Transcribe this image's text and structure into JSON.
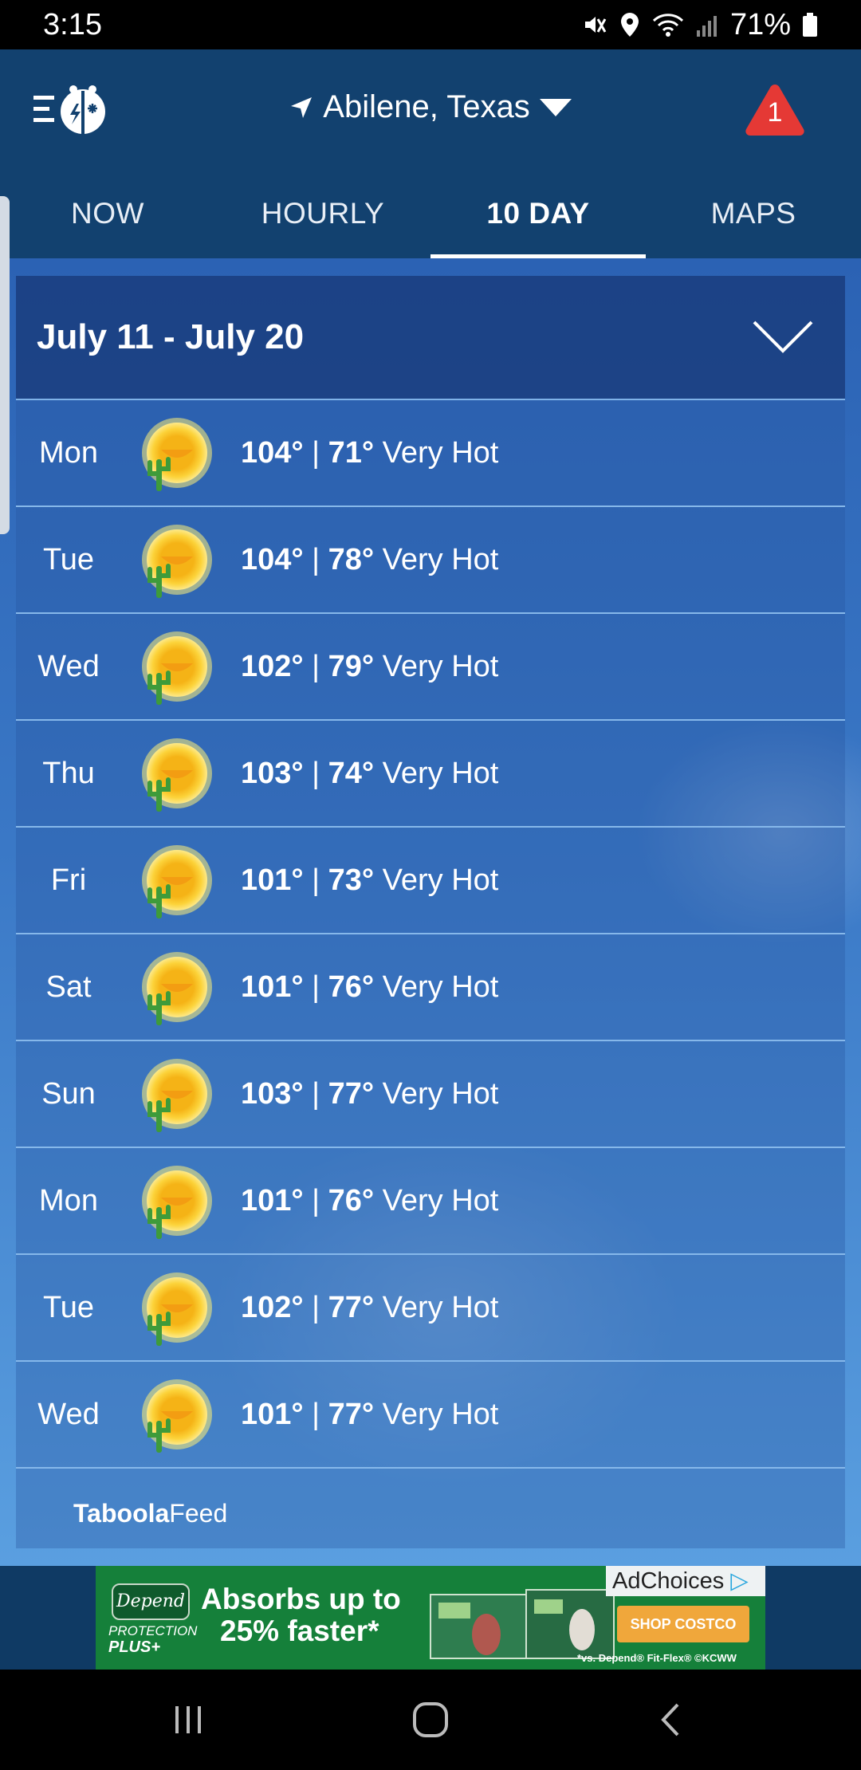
{
  "status_bar": {
    "time": "3:15",
    "battery": "71%",
    "icons": [
      "mute-icon",
      "location-icon",
      "wifi-icon",
      "signal-icon",
      "battery-icon"
    ]
  },
  "header": {
    "location": "Abilene, Texas",
    "alert_count": "1",
    "alert_color": "#e53935"
  },
  "tabs": [
    {
      "label": "NOW"
    },
    {
      "label": "HOURLY"
    },
    {
      "label": "10 DAY",
      "active": true
    },
    {
      "label": "MAPS"
    }
  ],
  "forecast": {
    "range": "July 11 - July 20",
    "days": [
      {
        "day": "Mon",
        "high": "104°",
        "low": "71°",
        "desc": "Very Hot",
        "icon": "hot-sun-cactus-icon"
      },
      {
        "day": "Tue",
        "high": "104°",
        "low": "78°",
        "desc": "Very Hot",
        "icon": "hot-sun-cactus-icon"
      },
      {
        "day": "Wed",
        "high": "102°",
        "low": "79°",
        "desc": "Very Hot",
        "icon": "hot-sun-cactus-icon"
      },
      {
        "day": "Thu",
        "high": "103°",
        "low": "74°",
        "desc": "Very Hot",
        "icon": "hot-sun-cactus-icon"
      },
      {
        "day": "Fri",
        "high": "101°",
        "low": "73°",
        "desc": "Very Hot",
        "icon": "hot-sun-cactus-icon"
      },
      {
        "day": "Sat",
        "high": "101°",
        "low": "76°",
        "desc": "Very Hot",
        "icon": "hot-sun-cactus-icon"
      },
      {
        "day": "Sun",
        "high": "103°",
        "low": "77°",
        "desc": "Very Hot",
        "icon": "hot-sun-cactus-icon"
      },
      {
        "day": "Mon",
        "high": "101°",
        "low": "76°",
        "desc": "Very Hot",
        "icon": "hot-sun-cactus-icon"
      },
      {
        "day": "Tue",
        "high": "102°",
        "low": "77°",
        "desc": "Very Hot",
        "icon": "hot-sun-cactus-icon"
      },
      {
        "day": "Wed",
        "high": "101°",
        "low": "77°",
        "desc": "Very Hot",
        "icon": "hot-sun-cactus-icon"
      }
    ]
  },
  "feed": {
    "brand_bold": "Taboola",
    "brand_light": "Feed"
  },
  "ad": {
    "brand": "Depend",
    "sub_line1": "PROTECTION",
    "sub_line2": "PLUS+",
    "headline_line1": "Absorbs up to",
    "headline_line2": "25% faster*",
    "adchoices": "AdChoices",
    "cta": "SHOP COSTCO",
    "fine_print": "*vs. Depend® Fit-Flex® ©KCWW"
  },
  "colors": {
    "header_bg": "#12416f",
    "content_gradient_top": "#2b62b4",
    "content_gradient_bottom": "#5a9fe0",
    "sun": "#f5c518",
    "cactus": "#3e9b3a"
  }
}
